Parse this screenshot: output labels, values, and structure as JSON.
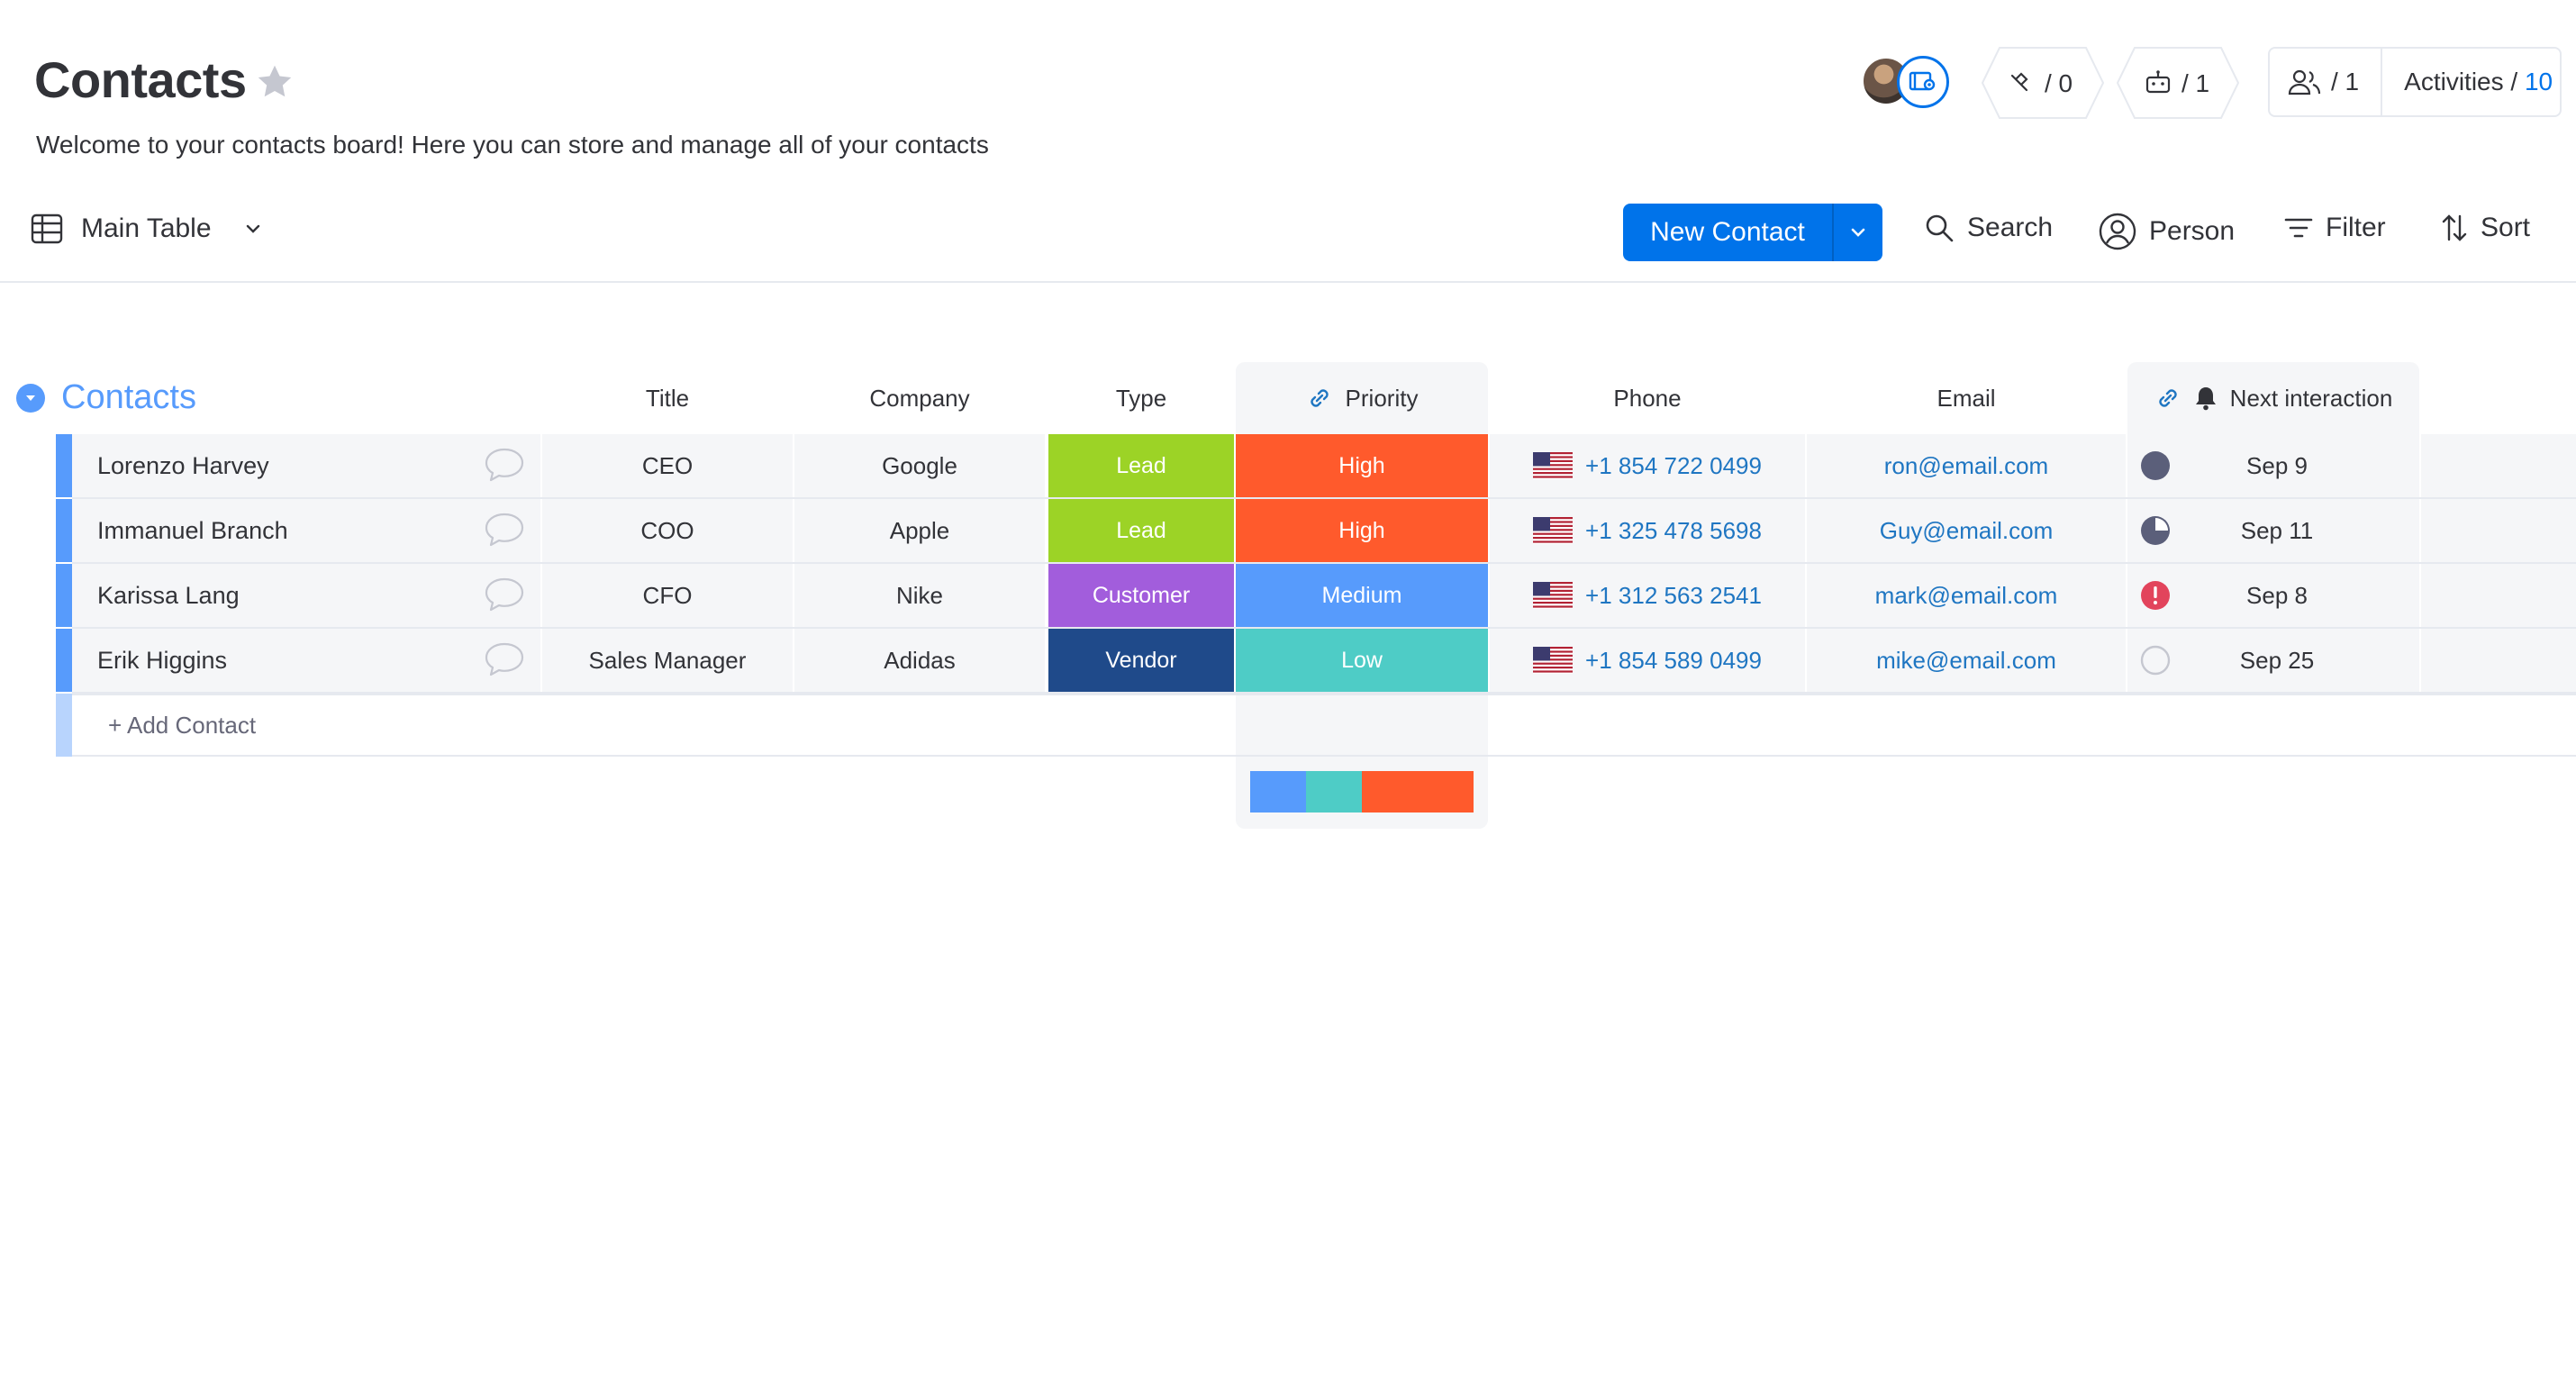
{
  "board": {
    "title": "Contacts",
    "description": "Welcome to your contacts board! Here you can store and manage all of your contacts"
  },
  "header_actions": {
    "integrations_count": "/ 0",
    "automations_count": "/ 1",
    "members_count": "/ 1",
    "activities_label": "Activities /",
    "activities_count": "10"
  },
  "toolbar": {
    "view_label": "Main Table",
    "new_item_label": "New Contact",
    "search_label": "Search",
    "person_label": "Person",
    "filter_label": "Filter",
    "sort_label": "Sort"
  },
  "group": {
    "name": "Contacts",
    "columns": {
      "title": "Title",
      "company": "Company",
      "type": "Type",
      "priority": "Priority",
      "phone": "Phone",
      "email": "Email",
      "next_interaction": "Next interaction"
    },
    "rows": [
      {
        "name": "Lorenzo Harvey",
        "title": "CEO",
        "company": "Google",
        "type": "Lead",
        "type_color": "#9cd326",
        "priority": "High",
        "priority_color": "#ff5a2c",
        "phone": "+1 854 722 0499",
        "email": "ron@email.com",
        "status_icon": "filled-circle-icon",
        "date": "Sep 9"
      },
      {
        "name": "Immanuel Branch",
        "title": "COO",
        "company": "Apple",
        "type": "Lead",
        "type_color": "#9cd326",
        "priority": "High",
        "priority_color": "#ff5a2c",
        "phone": "+1 325 478 5698",
        "email": "Guy@email.com",
        "status_icon": "three-quarter-circle-icon",
        "date": "Sep 11"
      },
      {
        "name": "Karissa Lang",
        "title": "CFO",
        "company": "Nike",
        "type": "Customer",
        "type_color": "#a25ddc",
        "priority": "Medium",
        "priority_color": "#579bfc",
        "phone": "+1 312 563 2541",
        "email": "mark@email.com",
        "status_icon": "alert-circle-icon",
        "date": "Sep 8"
      },
      {
        "name": "Erik Higgins",
        "title": "Sales Manager",
        "company": "Adidas",
        "type": "Vendor",
        "type_color": "#1f4a8a",
        "priority": "Low",
        "priority_color": "#4eccc6",
        "phone": "+1 854 589 0499",
        "email": "mike@email.com",
        "status_icon": "empty-circle-icon",
        "date": "Sep 25"
      }
    ],
    "add_item_label": "+ Add Contact",
    "priority_summary": [
      {
        "label": "Medium",
        "share": 0.25,
        "color": "#579bfc"
      },
      {
        "label": "Low",
        "share": 0.25,
        "color": "#4eccc6"
      },
      {
        "label": "High",
        "share": 0.5,
        "color": "#ff5a2c"
      }
    ]
  }
}
